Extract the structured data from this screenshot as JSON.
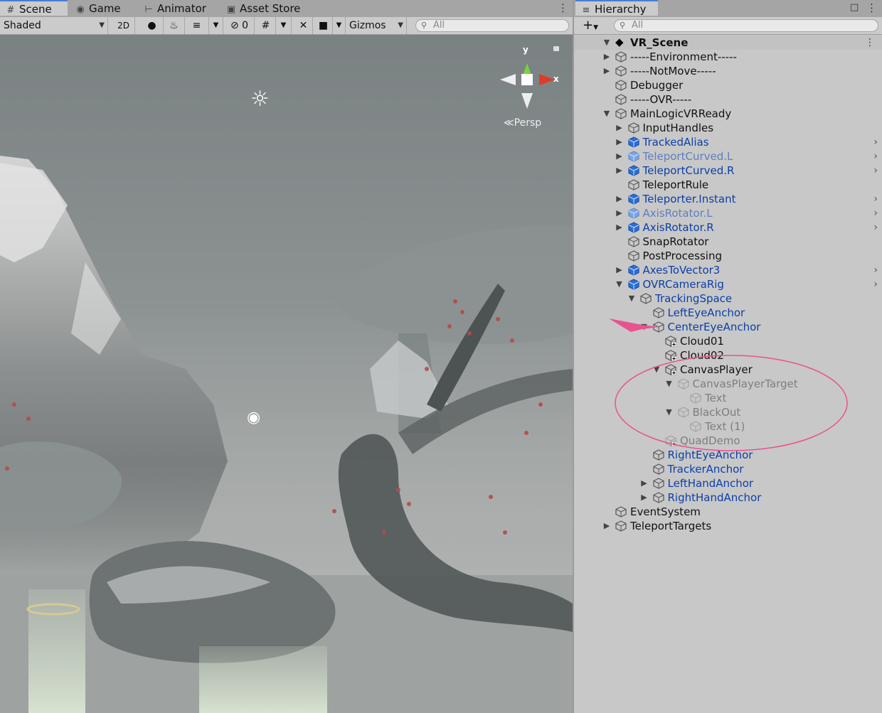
{
  "scene_panel": {
    "tabs": [
      {
        "label": "Scene",
        "icon": "grid-icon",
        "active": true
      },
      {
        "label": "Game",
        "icon": "gamepad-icon",
        "active": false
      },
      {
        "label": "Animator",
        "icon": "animator-icon",
        "active": false
      },
      {
        "label": "Asset Store",
        "icon": "shopping-bag-icon",
        "active": false
      }
    ],
    "toolbar": {
      "shading_mode": "Shaded",
      "mode_2d": "2D",
      "hidden_count": "0",
      "gizmos_label": "Gizmos",
      "search_placeholder": "All"
    },
    "viewport": {
      "gizmo_y": "y",
      "gizmo_x": "x",
      "projection": "Persp"
    }
  },
  "hierarchy": {
    "tab_label": "Hierarchy",
    "search_placeholder": "All",
    "scene_name": "VR_Scene",
    "items": [
      {
        "label": "-----Environment-----",
        "depth": 0,
        "expand": "collapsed",
        "kind": "normal"
      },
      {
        "label": "-----NotMove-----",
        "depth": 0,
        "expand": "collapsed",
        "kind": "normal"
      },
      {
        "label": "Debugger",
        "depth": 0,
        "expand": "none",
        "kind": "normal"
      },
      {
        "label": "-----OVR-----",
        "depth": 0,
        "expand": "none",
        "kind": "normal"
      },
      {
        "label": "MainLogicVRReady",
        "depth": 0,
        "expand": "expanded",
        "kind": "normal"
      },
      {
        "label": "InputHandles",
        "depth": 1,
        "expand": "collapsed",
        "kind": "normal"
      },
      {
        "label": "TrackedAlias",
        "depth": 1,
        "expand": "collapsed",
        "kind": "prefab",
        "chevron": true
      },
      {
        "label": "TeleportCurved.L",
        "depth": 1,
        "expand": "collapsed",
        "kind": "prefab-dim",
        "chevron": true
      },
      {
        "label": "TeleportCurved.R",
        "depth": 1,
        "expand": "collapsed",
        "kind": "prefab",
        "chevron": true
      },
      {
        "label": "TeleportRule",
        "depth": 1,
        "expand": "none",
        "kind": "normal"
      },
      {
        "label": "Teleporter.Instant",
        "depth": 1,
        "expand": "collapsed",
        "kind": "prefab",
        "chevron": true
      },
      {
        "label": "AxisRotator.L",
        "depth": 1,
        "expand": "collapsed",
        "kind": "prefab-dim",
        "chevron": true
      },
      {
        "label": "AxisRotator.R",
        "depth": 1,
        "expand": "collapsed",
        "kind": "prefab",
        "chevron": true
      },
      {
        "label": "SnapRotator",
        "depth": 1,
        "expand": "none",
        "kind": "normal"
      },
      {
        "label": "PostProcessing",
        "depth": 1,
        "expand": "none",
        "kind": "normal"
      },
      {
        "label": "AxesToVector3",
        "depth": 1,
        "expand": "collapsed",
        "kind": "prefab",
        "chevron": true
      },
      {
        "label": "OVRCameraRig",
        "depth": 1,
        "expand": "expanded",
        "kind": "prefab",
        "chevron": true
      },
      {
        "label": "TrackingSpace",
        "depth": 2,
        "expand": "expanded",
        "kind": "prefab-child"
      },
      {
        "label": "LeftEyeAnchor",
        "depth": 3,
        "expand": "none",
        "kind": "prefab-child"
      },
      {
        "label": "CenterEyeAnchor",
        "depth": 3,
        "expand": "expanded",
        "kind": "prefab-child"
      },
      {
        "label": "Cloud01",
        "depth": 4,
        "expand": "none",
        "kind": "added"
      },
      {
        "label": "Cloud02",
        "depth": 4,
        "expand": "none",
        "kind": "added"
      },
      {
        "label": "CanvasPlayer",
        "depth": 4,
        "expand": "expanded",
        "kind": "added"
      },
      {
        "label": "CanvasPlayerTarget",
        "depth": 5,
        "expand": "expanded",
        "kind": "inactive"
      },
      {
        "label": "Text",
        "depth": 6,
        "expand": "none",
        "kind": "inactive"
      },
      {
        "label": "BlackOut",
        "depth": 5,
        "expand": "expanded",
        "kind": "inactive"
      },
      {
        "label": "Text (1)",
        "depth": 6,
        "expand": "none",
        "kind": "inactive"
      },
      {
        "label": "QuadDemo",
        "depth": 4,
        "expand": "none",
        "kind": "inactive-added"
      },
      {
        "label": "RightEyeAnchor",
        "depth": 3,
        "expand": "none",
        "kind": "prefab-child"
      },
      {
        "label": "TrackerAnchor",
        "depth": 3,
        "expand": "none",
        "kind": "prefab-child"
      },
      {
        "label": "LeftHandAnchor",
        "depth": 3,
        "expand": "collapsed",
        "kind": "prefab-child"
      },
      {
        "label": "RightHandAnchor",
        "depth": 3,
        "expand": "collapsed",
        "kind": "prefab-child"
      },
      {
        "label": "EventSystem",
        "depth": 0,
        "expand": "none",
        "kind": "normal"
      },
      {
        "label": "TeleportTargets",
        "depth": 0,
        "expand": "collapsed",
        "kind": "normal"
      }
    ]
  },
  "annotation_color": "#e8538f"
}
